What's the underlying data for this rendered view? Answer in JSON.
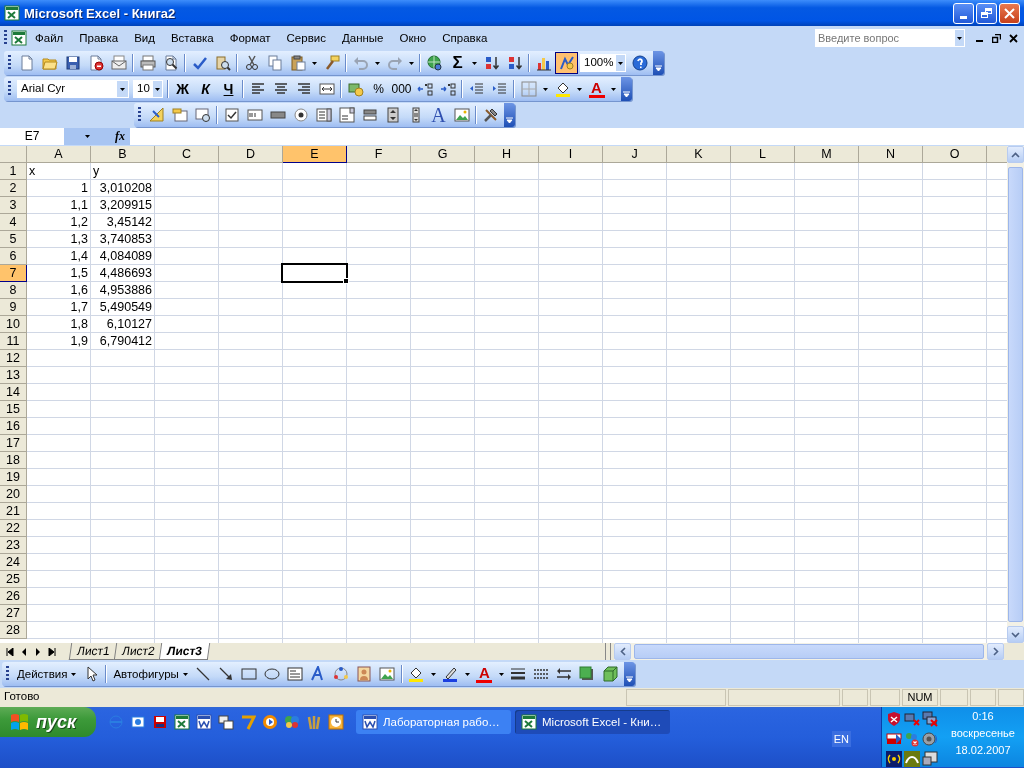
{
  "window": {
    "title": "Microsoft Excel - Книга2"
  },
  "menu": {
    "items": [
      "Файл",
      "Правка",
      "Вид",
      "Вставка",
      "Формат",
      "Сервис",
      "Данные",
      "Окно",
      "Справка"
    ],
    "help_search": {
      "placeholder": "Введите вопрос"
    }
  },
  "standard_toolbar": {
    "autosum": "Σ",
    "drawing_on": true,
    "zoom": "100%"
  },
  "formatting_toolbar": {
    "font": "Arial Cyr",
    "size": "10",
    "bold": "Ж",
    "italic": "К",
    "underline": "Ч",
    "percent": "%",
    "thousands": "000",
    "font_color": "A"
  },
  "forms_toolbar": {
    "label_tool": "A"
  },
  "formula_bar": {
    "name_box": "E7",
    "fx": "fx"
  },
  "sheet": {
    "columns": [
      {
        "label": "A",
        "selected": false
      },
      {
        "label": "B",
        "selected": false
      },
      {
        "label": "C",
        "selected": false
      },
      {
        "label": "D",
        "selected": false
      },
      {
        "label": "E",
        "selected": true
      },
      {
        "label": "F",
        "selected": false
      },
      {
        "label": "G",
        "selected": false
      },
      {
        "label": "H",
        "selected": false
      },
      {
        "label": "I",
        "selected": false
      },
      {
        "label": "J",
        "selected": false
      },
      {
        "label": "K",
        "selected": false
      },
      {
        "label": "L",
        "selected": false
      },
      {
        "label": "M",
        "selected": false
      },
      {
        "label": "N",
        "selected": false
      },
      {
        "label": "O",
        "selected": false
      }
    ],
    "rows": [
      {
        "label": "1",
        "selected": false,
        "cells": [
          {
            "value": "x",
            "kind": "text"
          },
          {
            "value": "y",
            "kind": "text"
          }
        ]
      },
      {
        "label": "2",
        "selected": false,
        "cells": [
          {
            "value": "1",
            "kind": "number"
          },
          {
            "value": "3,010208",
            "kind": "number"
          }
        ]
      },
      {
        "label": "3",
        "selected": false,
        "cells": [
          {
            "value": "1,1",
            "kind": "number"
          },
          {
            "value": "3,209915",
            "kind": "number"
          }
        ]
      },
      {
        "label": "4",
        "selected": false,
        "cells": [
          {
            "value": "1,2",
            "kind": "number"
          },
          {
            "value": "3,45142",
            "kind": "number"
          }
        ]
      },
      {
        "label": "5",
        "selected": false,
        "cells": [
          {
            "value": "1,3",
            "kind": "number"
          },
          {
            "value": "3,740853",
            "kind": "number"
          }
        ]
      },
      {
        "label": "6",
        "selected": false,
        "cells": [
          {
            "value": "1,4",
            "kind": "number"
          },
          {
            "value": "4,084089",
            "kind": "number"
          }
        ]
      },
      {
        "label": "7",
        "selected": true,
        "cells": [
          {
            "value": "1,5",
            "kind": "number"
          },
          {
            "value": "4,486693",
            "kind": "number"
          }
        ]
      },
      {
        "label": "8",
        "selected": false,
        "cells": [
          {
            "value": "1,6",
            "kind": "number"
          },
          {
            "value": "4,953886",
            "kind": "number"
          }
        ]
      },
      {
        "label": "9",
        "selected": false,
        "cells": [
          {
            "value": "1,7",
            "kind": "number"
          },
          {
            "value": "5,490549",
            "kind": "number"
          }
        ]
      },
      {
        "label": "10",
        "selected": false,
        "cells": [
          {
            "value": "1,8",
            "kind": "number"
          },
          {
            "value": "6,10127",
            "kind": "number"
          }
        ]
      },
      {
        "label": "11",
        "selected": false,
        "cells": [
          {
            "value": "1,9",
            "kind": "number"
          },
          {
            "value": "6,790412",
            "kind": "number"
          }
        ]
      },
      {
        "label": "12",
        "selected": false
      },
      {
        "label": "13",
        "selected": false
      },
      {
        "label": "14",
        "selected": false
      },
      {
        "label": "15",
        "selected": false
      },
      {
        "label": "16",
        "selected": false
      },
      {
        "label": "17",
        "selected": false
      },
      {
        "label": "18",
        "selected": false
      },
      {
        "label": "19",
        "selected": false
      },
      {
        "label": "20",
        "selected": false
      },
      {
        "label": "21",
        "selected": false
      },
      {
        "label": "22",
        "selected": false
      },
      {
        "label": "23",
        "selected": false
      },
      {
        "label": "24",
        "selected": false
      },
      {
        "label": "25",
        "selected": false
      },
      {
        "label": "26",
        "selected": false
      },
      {
        "label": "27",
        "selected": false
      },
      {
        "label": "28",
        "selected": false
      }
    ]
  },
  "sheet_tabs": [
    {
      "label": "Лист1",
      "selected": false
    },
    {
      "label": "Лист2",
      "selected": false
    },
    {
      "label": "Лист3",
      "selected": true
    }
  ],
  "drawing_toolbar": {
    "actions": "Действия",
    "autoshapes": "Автофигуры",
    "font_color": "A"
  },
  "status_bar": {
    "text": "Готово",
    "indicator": "NUM"
  },
  "taskbar": {
    "start": "пуск",
    "tasks": [
      {
        "label": "Лабораторная рабо…",
        "kind": "word",
        "selected": false
      },
      {
        "label": "Microsoft Excel - Кни…",
        "kind": "excel",
        "selected": true
      }
    ],
    "language": "EN",
    "clock": {
      "time": "0:16",
      "day": "воскресенье",
      "date": "18.02.2007"
    }
  }
}
